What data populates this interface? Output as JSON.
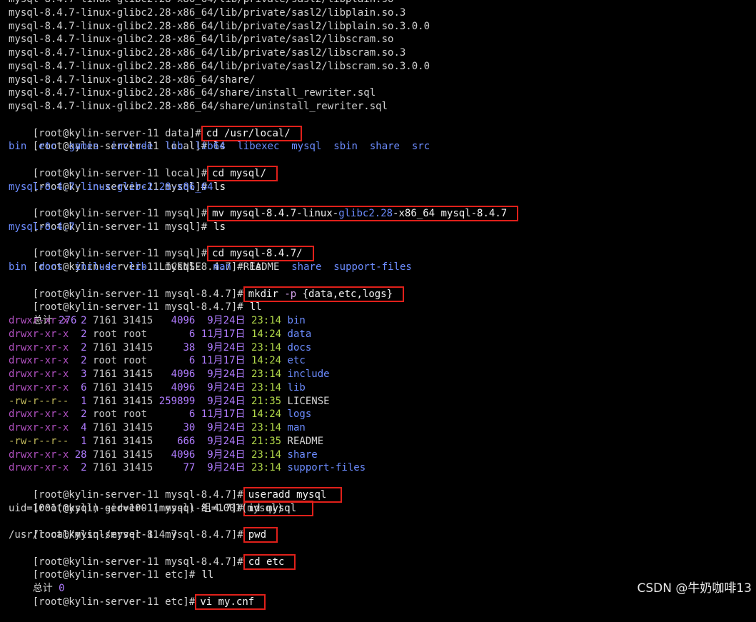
{
  "colors": {
    "background": "#000000",
    "text": "#d2d2d2",
    "directory": "#6c8cff",
    "highlight_box": "#e0201a",
    "time": "#b2d94a",
    "number": "#b07cff"
  },
  "extract_lines": [
    "mysql-8.4.7-linux-glibc2.28-x86_64/lib/private/sasl2/libplain.so",
    "mysql-8.4.7-linux-glibc2.28-x86_64/lib/private/sasl2/libplain.so.3",
    "mysql-8.4.7-linux-glibc2.28-x86_64/lib/private/sasl2/libplain.so.3.0.0",
    "mysql-8.4.7-linux-glibc2.28-x86_64/lib/private/sasl2/libscram.so",
    "mysql-8.4.7-linux-glibc2.28-x86_64/lib/private/sasl2/libscram.so.3",
    "mysql-8.4.7-linux-glibc2.28-x86_64/lib/private/sasl2/libscram.so.3.0.0",
    "mysql-8.4.7-linux-glibc2.28-x86_64/share/",
    "mysql-8.4.7-linux-glibc2.28-x86_64/share/install_rewriter.sql",
    "mysql-8.4.7-linux-glibc2.28-x86_64/share/uninstall_rewriter.sql"
  ],
  "session": {
    "p_data": "[root@kylin-server-11 data]",
    "p_local": "[root@kylin-server-11 local]",
    "p_mysql": "[root@kylin-server-11 mysql]",
    "p_ver": "[root@kylin-server-11 mysql-8.4.7]",
    "p_etc": "[root@kylin-server-11 etc]",
    "hash": "#",
    "c1": "cd /usr/local/",
    "c2": "ls",
    "ls_local": [
      "bin",
      "etc",
      "games",
      "include",
      "lib",
      "lib64",
      "libexec",
      "mysql",
      "sbin",
      "share",
      "src"
    ],
    "c3": "cd mysql/",
    "c4": "ls",
    "ls_mysql": "mysql-8.4.7-linux-glibc2.28-x86_64",
    "c5_a": "mv mysql-8.4.7-linux-",
    "c5_b": "glibc2.28",
    "c5_c": "-x86_64 mysql-8.4.7",
    "c6": "ls",
    "ls_mysql2": "mysql-8.4.7",
    "c7": "cd mysql-8.4.7/",
    "c8": "ls",
    "ls_ver": [
      {
        "name": "bin",
        "dir": true
      },
      {
        "name": "docs",
        "dir": true
      },
      {
        "name": "include",
        "dir": true
      },
      {
        "name": "lib",
        "dir": true
      },
      {
        "name": "LICENSE",
        "dir": false
      },
      {
        "name": "man",
        "dir": true
      },
      {
        "name": "README",
        "dir": false
      },
      {
        "name": "share",
        "dir": true
      },
      {
        "name": "support-files",
        "dir": true
      }
    ],
    "c9_cmd": "mkdir",
    "c9_opt": " -p ",
    "c9_arg": "{data,etc,logs}",
    "c10": "ll",
    "total_label": "总计",
    "total_value": "276",
    "ll_rows": [
      {
        "perm": "drwxr-xr-x",
        "links": " 2",
        "user": "7161",
        "group": "31415",
        "size": "  4096",
        "date": " 9月24日",
        "time": "23:14",
        "name": "bin",
        "dir": true
      },
      {
        "perm": "drwxr-xr-x",
        "links": " 2",
        "user": "root",
        "group": "root ",
        "size": "     6",
        "date": "11月17日",
        "time": "14:24",
        "name": "data",
        "dir": true
      },
      {
        "perm": "drwxr-xr-x",
        "links": " 2",
        "user": "7161",
        "group": "31415",
        "size": "    38",
        "date": " 9月24日",
        "time": "23:14",
        "name": "docs",
        "dir": true
      },
      {
        "perm": "drwxr-xr-x",
        "links": " 2",
        "user": "root",
        "group": "root ",
        "size": "     6",
        "date": "11月17日",
        "time": "14:24",
        "name": "etc",
        "dir": true
      },
      {
        "perm": "drwxr-xr-x",
        "links": " 3",
        "user": "7161",
        "group": "31415",
        "size": "  4096",
        "date": " 9月24日",
        "time": "23:14",
        "name": "include",
        "dir": true
      },
      {
        "perm": "drwxr-xr-x",
        "links": " 6",
        "user": "7161",
        "group": "31415",
        "size": "  4096",
        "date": " 9月24日",
        "time": "23:14",
        "name": "lib",
        "dir": true
      },
      {
        "perm": "-rw-r--r--",
        "links": " 1",
        "user": "7161",
        "group": "31415",
        "size": "259899",
        "date": " 9月24日",
        "time": "21:35",
        "name": "LICENSE",
        "dir": false
      },
      {
        "perm": "drwxr-xr-x",
        "links": " 2",
        "user": "root",
        "group": "root ",
        "size": "     6",
        "date": "11月17日",
        "time": "14:24",
        "name": "logs",
        "dir": true
      },
      {
        "perm": "drwxr-xr-x",
        "links": " 4",
        "user": "7161",
        "group": "31415",
        "size": "    30",
        "date": " 9月24日",
        "time": "23:14",
        "name": "man",
        "dir": true
      },
      {
        "perm": "-rw-r--r--",
        "links": " 1",
        "user": "7161",
        "group": "31415",
        "size": "   666",
        "date": " 9月24日",
        "time": "21:35",
        "name": "README",
        "dir": false
      },
      {
        "perm": "drwxr-xr-x",
        "links": "28",
        "user": "7161",
        "group": "31415",
        "size": "  4096",
        "date": " 9月24日",
        "time": "23:14",
        "name": "share",
        "dir": true
      },
      {
        "perm": "drwxr-xr-x",
        "links": " 2",
        "user": "7161",
        "group": "31415",
        "size": "    77",
        "date": " 9月24日",
        "time": "23:14",
        "name": "support-files",
        "dir": true
      }
    ],
    "c11": "useradd mysql",
    "c12": "id mysql",
    "id_out": "uid=1001(mysql) gid=1001(mysql) 组=1001(mysql)",
    "c13": "pwd",
    "pwd_out": "/usr/local/mysql/mysql-8.4.7",
    "c14": "cd etc",
    "c15": "ll",
    "total_value2": "0",
    "c16": "vi my.cnf"
  },
  "watermark": "CSDN @牛奶咖啡13"
}
